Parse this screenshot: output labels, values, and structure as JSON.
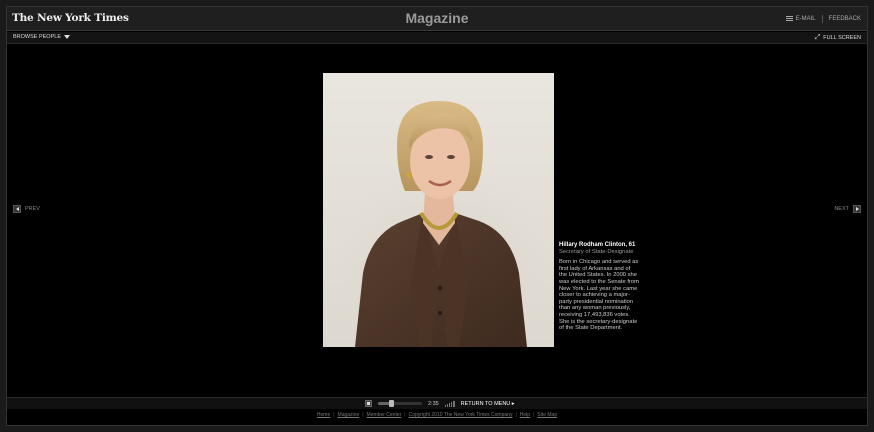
{
  "header": {
    "logo_text": "The New York Times",
    "title": "Magazine",
    "email_label": "E-MAIL",
    "feedback_label": "FEEDBACK"
  },
  "subbar": {
    "browse_label": "BROWSE PEOPLE",
    "fullscreen_label": "FULL SCREEN"
  },
  "nav": {
    "prev_label": "PREV",
    "next_label": "NEXT"
  },
  "caption": {
    "name": "Hillary Rodham Clinton, 61",
    "role": "Secretary of State-Designate",
    "bio": "Born in Chicago and served as first lady of Arkansas and of the United States. In 2000 she was elected to the Senate from New York. Last year she came closer to achieving a major-party presidential nomination than any woman previously, receiving 17,493,836 votes. She is the secretary-designate of the State Department."
  },
  "player": {
    "time": "2:35",
    "progress": 0.3,
    "return_label": "RETURN TO MENU ▸"
  },
  "footer": {
    "links": [
      "Home",
      "Magazine",
      "Member Center",
      "Copyright 2010 The New York Times Company",
      "Help",
      "Site Map"
    ]
  },
  "colors": {
    "background": "#000000",
    "bar": "#1f1f1f",
    "photo_bg": "#e6e2da"
  }
}
